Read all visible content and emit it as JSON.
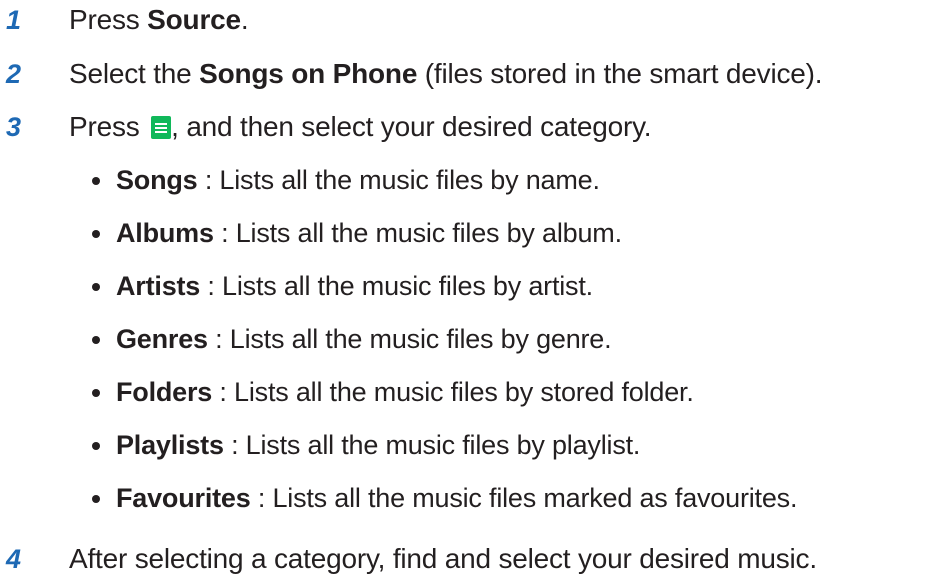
{
  "steps": [
    {
      "number": "1",
      "before": "Press ",
      "bold": "Source",
      "after": "."
    },
    {
      "number": "2",
      "before": "Select the ",
      "bold": "Songs on Phone",
      "after": " (files stored in the smart device)."
    },
    {
      "number": "3",
      "before": "Press ",
      "icon": "menu-icon",
      "after": ", and then select your desired category."
    },
    {
      "number": "4",
      "text": "After selecting a category, find and select your desired music."
    }
  ],
  "categories": [
    {
      "name": "Songs",
      "desc": " : Lists all the music files by name."
    },
    {
      "name": "Albums",
      "desc": " : Lists all the music files by album."
    },
    {
      "name": "Artists",
      "desc": " : Lists all the music files by artist."
    },
    {
      "name": "Genres",
      "desc": " : Lists all the music files by genre."
    },
    {
      "name": "Folders",
      "desc": " : Lists all the music files by stored folder."
    },
    {
      "name": "Playlists",
      "desc": " : Lists all the music files by playlist."
    },
    {
      "name": "Favourites",
      "desc": " : Lists all the music files marked as favourites."
    }
  ],
  "colors": {
    "step_number": "#1e69b4",
    "menu_icon": "#10b85a",
    "text": "#231f20"
  }
}
